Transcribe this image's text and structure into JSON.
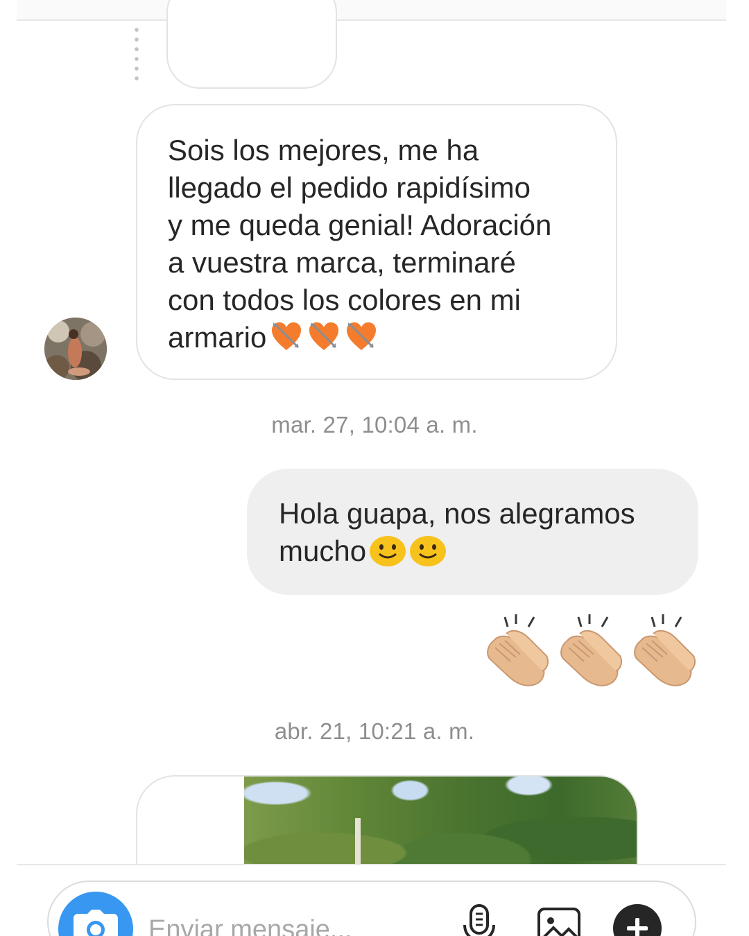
{
  "thread": {
    "incoming_message": {
      "text": "Sois los mejores, me ha\nllegado el pedido rapidísimo\ny me queda genial! Adoración\na vuestra marca, terminaré\ncon todos los colores en mi\narmario",
      "emoji": [
        "heart-with-arrow",
        "heart-with-arrow",
        "heart-with-arrow"
      ]
    },
    "timestamp_1": "mar. 27, 10:04 a. m.",
    "outgoing_message": {
      "text": "Hola guapa, nos alegramos\nmucho",
      "emoji": [
        "smiling-face",
        "smiling-face"
      ]
    },
    "outgoing_reaction_emoji": [
      "clapping-hands",
      "clapping-hands",
      "clapping-hands"
    ],
    "timestamp_2": "abr. 21, 10:21 a. m.",
    "incoming_media": {
      "type": "photo"
    }
  },
  "composer": {
    "placeholder": "Enviar mensaje...",
    "value": "",
    "icons": [
      "camera-icon",
      "microphone-icon",
      "image-icon",
      "plus-icon"
    ]
  },
  "colors": {
    "camera_button": "#3897f0",
    "incoming_bubble_border": "#e3e3e3",
    "outgoing_bubble_bg": "#efefef",
    "timestamp_text": "#8e8e8e",
    "message_text": "#262626"
  }
}
